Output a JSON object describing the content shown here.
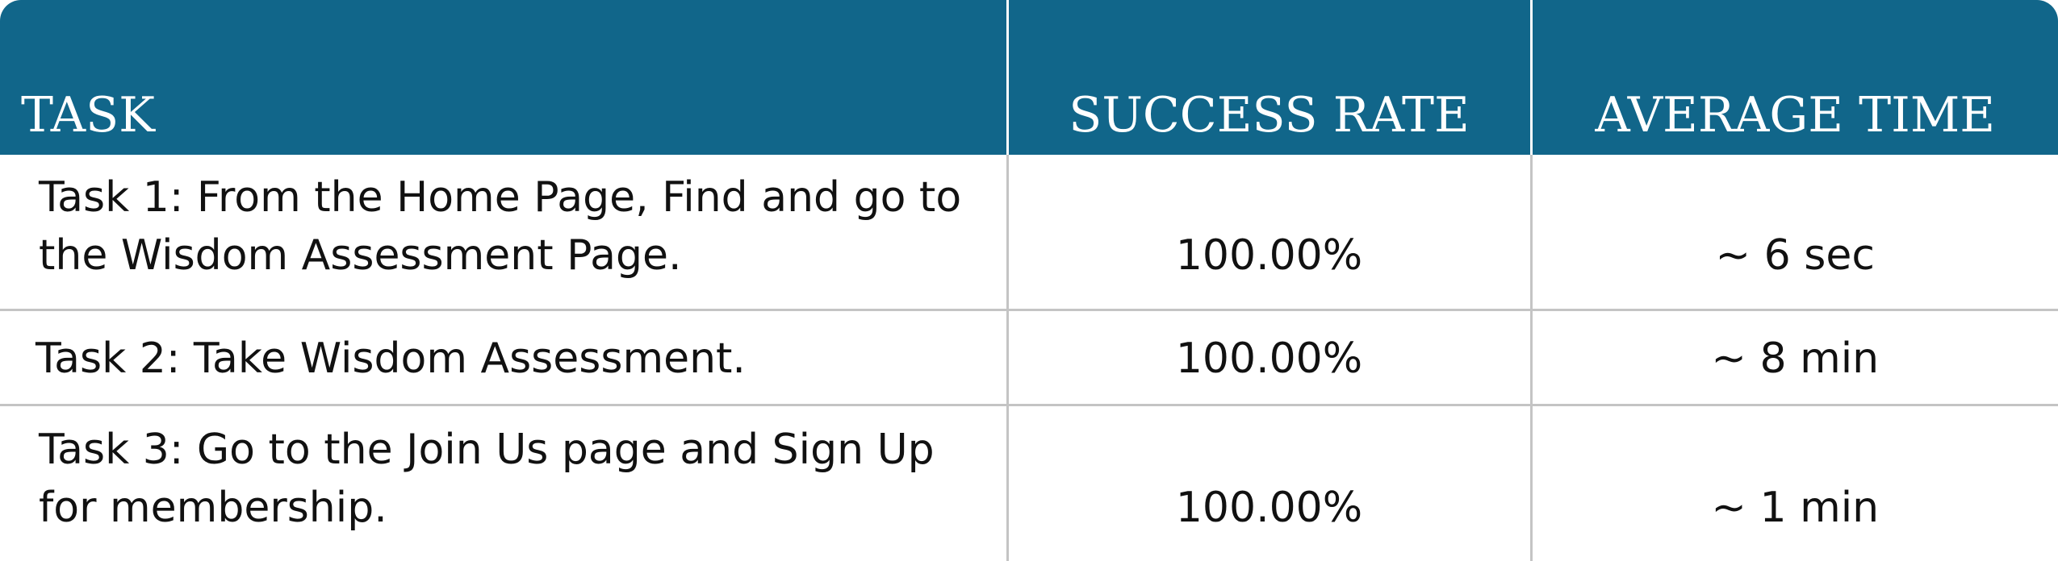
{
  "table": {
    "headers": {
      "task": "TASK",
      "success_rate": "SUCCESS RATE",
      "average_time": "AVERAGE TIME"
    },
    "rows": [
      {
        "task": "Task 1: From the Home Page, Find and go to the Wisdom Assessment Page.",
        "success_rate": "100.00%",
        "average_time": "~ 6 sec"
      },
      {
        "task": "Task 2: Take Wisdom Assessment.",
        "success_rate": "100.00%",
        "average_time": "~ 8 min"
      },
      {
        "task": "Task 3: Go to the Join Us page and Sign Up for membership.",
        "success_rate": "100.00%",
        "average_time": "~ 1 min"
      }
    ]
  },
  "colors": {
    "header_background": "#11668a",
    "header_text": "#ffffff",
    "body_text": "#111111",
    "grid_line": "#c4c4c4"
  }
}
